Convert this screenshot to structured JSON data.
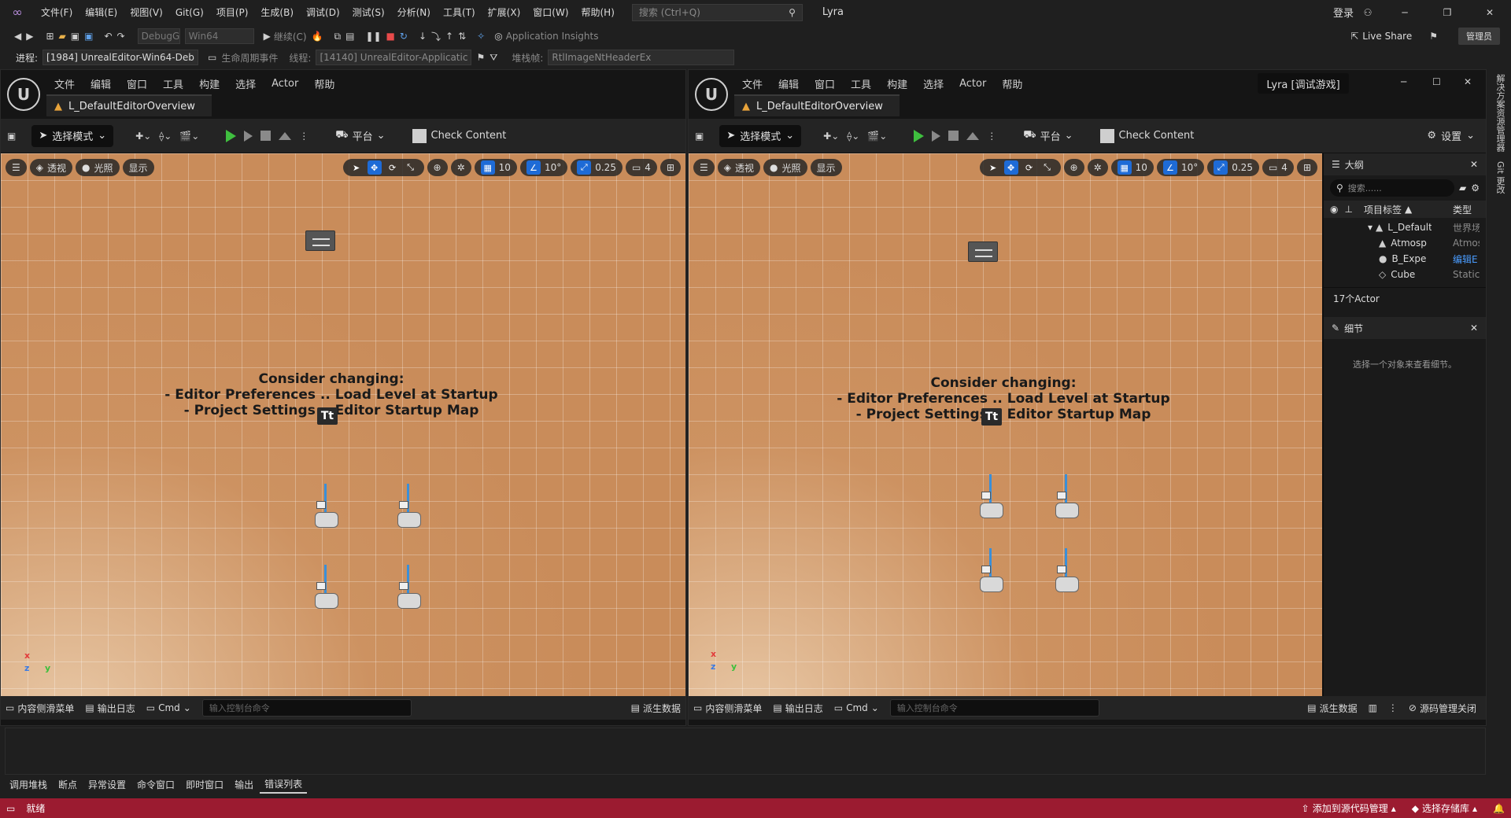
{
  "vs": {
    "menu": [
      "文件(F)",
      "编辑(E)",
      "视图(V)",
      "Git(G)",
      "项目(P)",
      "生成(B)",
      "调试(D)",
      "测试(S)",
      "分析(N)",
      "工具(T)",
      "扩展(X)",
      "窗口(W)",
      "帮助(H)"
    ],
    "search_placeholder": "搜索 (Ctrl+Q)",
    "solution": "Lyra",
    "login": "登录",
    "config": "DebugG",
    "platform": "Win64",
    "continue": "继续(C)",
    "app_insights": "Application Insights",
    "live_share": "Live Share",
    "admin": "管理员",
    "process_label": "进程:",
    "process": "[1984] UnrealEditor-Win64-Deb",
    "lifecycle": "生命周期事件",
    "thread_label": "线程:",
    "thread": "[14140] UnrealEditor-Applicatic",
    "stack_label": "堆栈帧:",
    "stack": "RtlImageNtHeaderEx",
    "right_side": [
      "解决方案资源管理器",
      "Git 更改"
    ],
    "bottom_tabs": [
      "调用堆栈",
      "断点",
      "异常设置",
      "命令窗口",
      "即时窗口",
      "输出",
      "错误列表"
    ],
    "status_ready": "就绪",
    "status_add_source": "添加到源代码管理",
    "status_repo": "选择存储库"
  },
  "ue": {
    "menu": [
      "文件",
      "编辑",
      "窗口",
      "工具",
      "构建",
      "选择",
      "Actor",
      "帮助"
    ],
    "tab": "L_DefaultEditorOverview",
    "select_mode": "选择模式",
    "platform": "平台",
    "check_content": "Check Content",
    "settings": "设置",
    "vp_perspective": "透视",
    "vp_lit": "光照",
    "vp_show": "显示",
    "grid": "10",
    "angle": "10°",
    "scale": "0.25",
    "cam": "4",
    "msg_line1": "Consider changing:",
    "msg_line2": "- Editor Preferences .. Load Level at Startup",
    "msg_line3": "- Project Settings .. Editor Startup Map",
    "bottom_drawer": "内容侧滑菜单",
    "output_log": "输出日志",
    "cmd": "Cmd",
    "console_placeholder": "输入控制台命令",
    "derived_data": "派生数据",
    "source_control": "源码管理关闭",
    "window_title": "Lyra [调试游戏]",
    "outliner": {
      "title": "大纲",
      "search_placeholder": "搜索......",
      "col_label": "项目标签",
      "col_type": "类型",
      "rows": [
        {
          "name": "L_Default",
          "type": "世界场"
        },
        {
          "name": "Atmosp",
          "type": "Atmos"
        },
        {
          "name": "B_Expe",
          "type": "编辑E"
        },
        {
          "name": "Cube",
          "type": "Static"
        }
      ],
      "count": "17个Actor"
    },
    "details": {
      "title": "细节",
      "empty": "选择一个对象来查看细节。"
    }
  },
  "colors": {
    "vs_status": "#9b1b30",
    "play": "#3fbf3f",
    "accent": "#1e6bd6",
    "floor": "#c98c5a"
  }
}
